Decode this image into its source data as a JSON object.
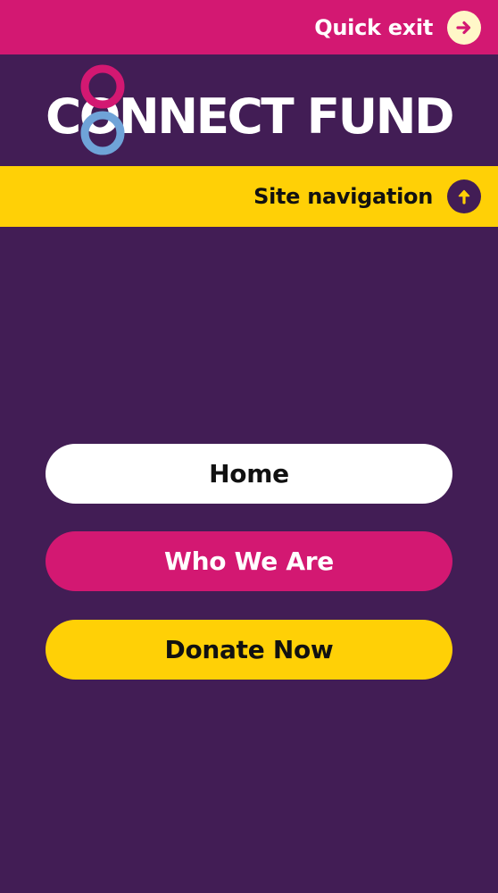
{
  "quick_exit": {
    "label": "Quick exit",
    "icon": "arrow-right-icon"
  },
  "logo": {
    "text": "CONNECT FUND",
    "colors": [
      "#d31872",
      "#6fa3d8"
    ]
  },
  "site_nav": {
    "label": "Site navigation",
    "icon": "arrow-up-icon"
  },
  "menu": {
    "items": [
      {
        "label": "Home"
      },
      {
        "label": "Who We Are"
      },
      {
        "label": "Donate Now"
      }
    ]
  },
  "colors": {
    "background": "#421d55",
    "magenta": "#d31872",
    "yellow": "#ffd006",
    "white": "#ffffff"
  }
}
